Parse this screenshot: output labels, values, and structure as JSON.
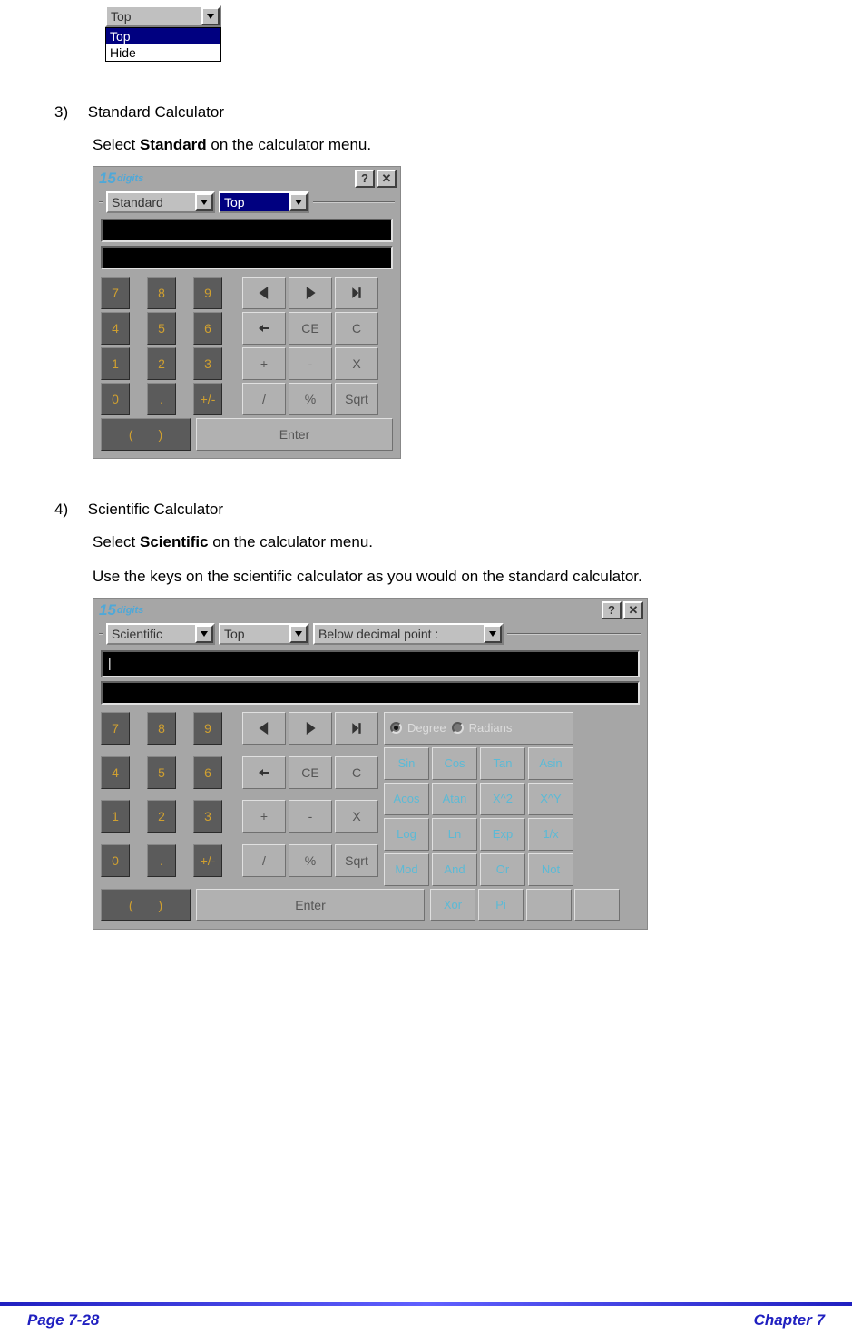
{
  "top_dropdown": {
    "selected": "Top",
    "options": [
      "Top",
      "Hide"
    ]
  },
  "section3": {
    "num": "3)",
    "title": "Standard Calculator",
    "instr_pre": "Select ",
    "instr_bold": "Standard",
    "instr_post": " on the calculator menu."
  },
  "section4": {
    "num": "4)",
    "title": "Scientific Calculator",
    "instr_pre": "Select ",
    "instr_bold": "Scientific",
    "instr_post": " on the calculator menu.",
    "line2": "Use the keys on the scientific calculator as you would on the standard calculator."
  },
  "calc_brand_num": "15",
  "calc_brand_word": "digits",
  "std": {
    "mode_dd": "Standard",
    "top_dd": "Top",
    "help": "?",
    "close": "✕",
    "nums": [
      "7",
      "8",
      "9",
      "4",
      "5",
      "6",
      "1",
      "2",
      "3",
      "0",
      ".",
      "+/-"
    ],
    "ops_row1": [
      "◀",
      "▶",
      "▶|"
    ],
    "ops_row2": [
      "←",
      "CE",
      "C"
    ],
    "ops_row3": [
      "+",
      "-",
      "X"
    ],
    "ops_row4": [
      "/",
      "%",
      "Sqrt"
    ],
    "paren": "()",
    "enter": "Enter"
  },
  "sci": {
    "mode_dd": "Scientific",
    "top_dd": "Top",
    "decimal_label": "Below decimal point :",
    "help": "?",
    "close": "✕",
    "cursor": "|",
    "nums": [
      "7",
      "8",
      "9",
      "4",
      "5",
      "6",
      "1",
      "2",
      "3",
      "0",
      ".",
      "+/-"
    ],
    "ops_row1": [
      "◀",
      "▶",
      "▶|"
    ],
    "ops_row2": [
      "←",
      "CE",
      "C"
    ],
    "ops_row3": [
      "+",
      "-",
      "X"
    ],
    "ops_row4": [
      "/",
      "%",
      "Sqrt"
    ],
    "angle_degree": "Degree",
    "angle_radians": "Radians",
    "fn_rows": [
      [
        "Sin",
        "Cos",
        "Tan",
        "Asin"
      ],
      [
        "Acos",
        "Atan",
        "X^2",
        "X^Y"
      ],
      [
        "Log",
        "Ln",
        "Exp",
        "1/x"
      ],
      [
        "Mod",
        "And",
        "Or",
        "Not"
      ]
    ],
    "paren": "()",
    "enter": "Enter",
    "fn_bottom": [
      "Xor",
      "Pi"
    ]
  },
  "footer": {
    "left": "Page 7-28",
    "right": "Chapter 7"
  }
}
